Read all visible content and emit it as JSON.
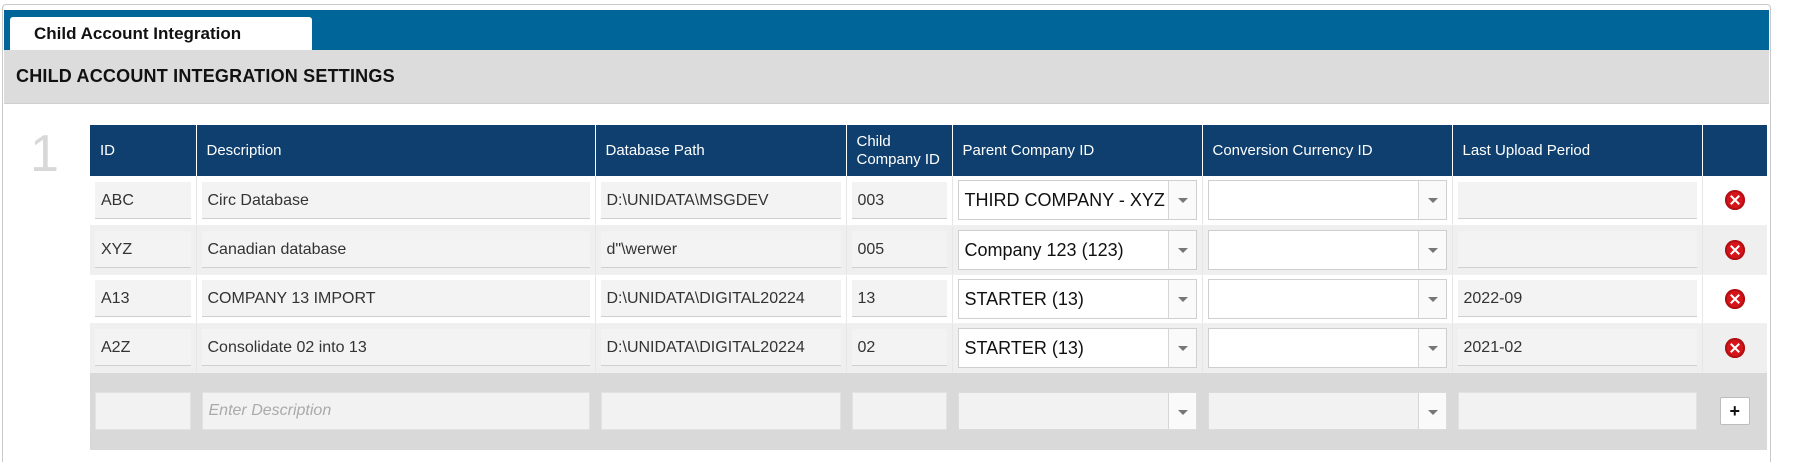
{
  "tab": {
    "label": "Child Account Integration Settings"
  },
  "section": {
    "title": "CHILD ACCOUNT INTEGRATION SETTINGS"
  },
  "row_number": "1",
  "columns": {
    "id": "ID",
    "description": "Description",
    "database_path": "Database Path",
    "child_company_id": "Child Company ID",
    "parent_company_id": "Parent Company ID",
    "conversion_currency_id": "Conversion Currency ID",
    "last_upload_period": "Last Upload Period"
  },
  "rows": [
    {
      "id": "ABC",
      "description": "Circ Database",
      "database_path": "D:\\UNIDATA\\MSGDEV",
      "child_company_id": "003",
      "parent_company_id": "THIRD COMPANY - XYZ",
      "conversion_currency_id": "",
      "last_upload_period": ""
    },
    {
      "id": "XYZ",
      "description": "Canadian database",
      "database_path": "d\"\\werwer",
      "child_company_id": "005",
      "parent_company_id": "Company 123 (123)",
      "conversion_currency_id": "",
      "last_upload_period": ""
    },
    {
      "id": "A13",
      "description": "COMPANY 13 IMPORT",
      "database_path": "D:\\UNIDATA\\DIGITAL20224",
      "child_company_id": "13",
      "parent_company_id": "STARTER (13)",
      "conversion_currency_id": "",
      "last_upload_period": "2022-09"
    },
    {
      "id": "A2Z",
      "description": "Consolidate 02 into 13",
      "database_path": "D:\\UNIDATA\\DIGITAL20224",
      "child_company_id": "02",
      "parent_company_id": "STARTER (13)",
      "conversion_currency_id": "",
      "last_upload_period": "2021-02"
    }
  ],
  "new_row": {
    "id": "",
    "description_placeholder": "Enter Description",
    "database_path": "",
    "child_company_id": "",
    "parent_company_id": "",
    "conversion_currency_id": "",
    "last_upload_period": "",
    "add_label": "+"
  },
  "icons": {
    "delete": "delete-circle-x-icon",
    "dropdown": "chevron-down-icon"
  },
  "colors": {
    "tab_bar": "#006699",
    "table_header": "#0e3f6e",
    "delete": "#d7141a"
  }
}
